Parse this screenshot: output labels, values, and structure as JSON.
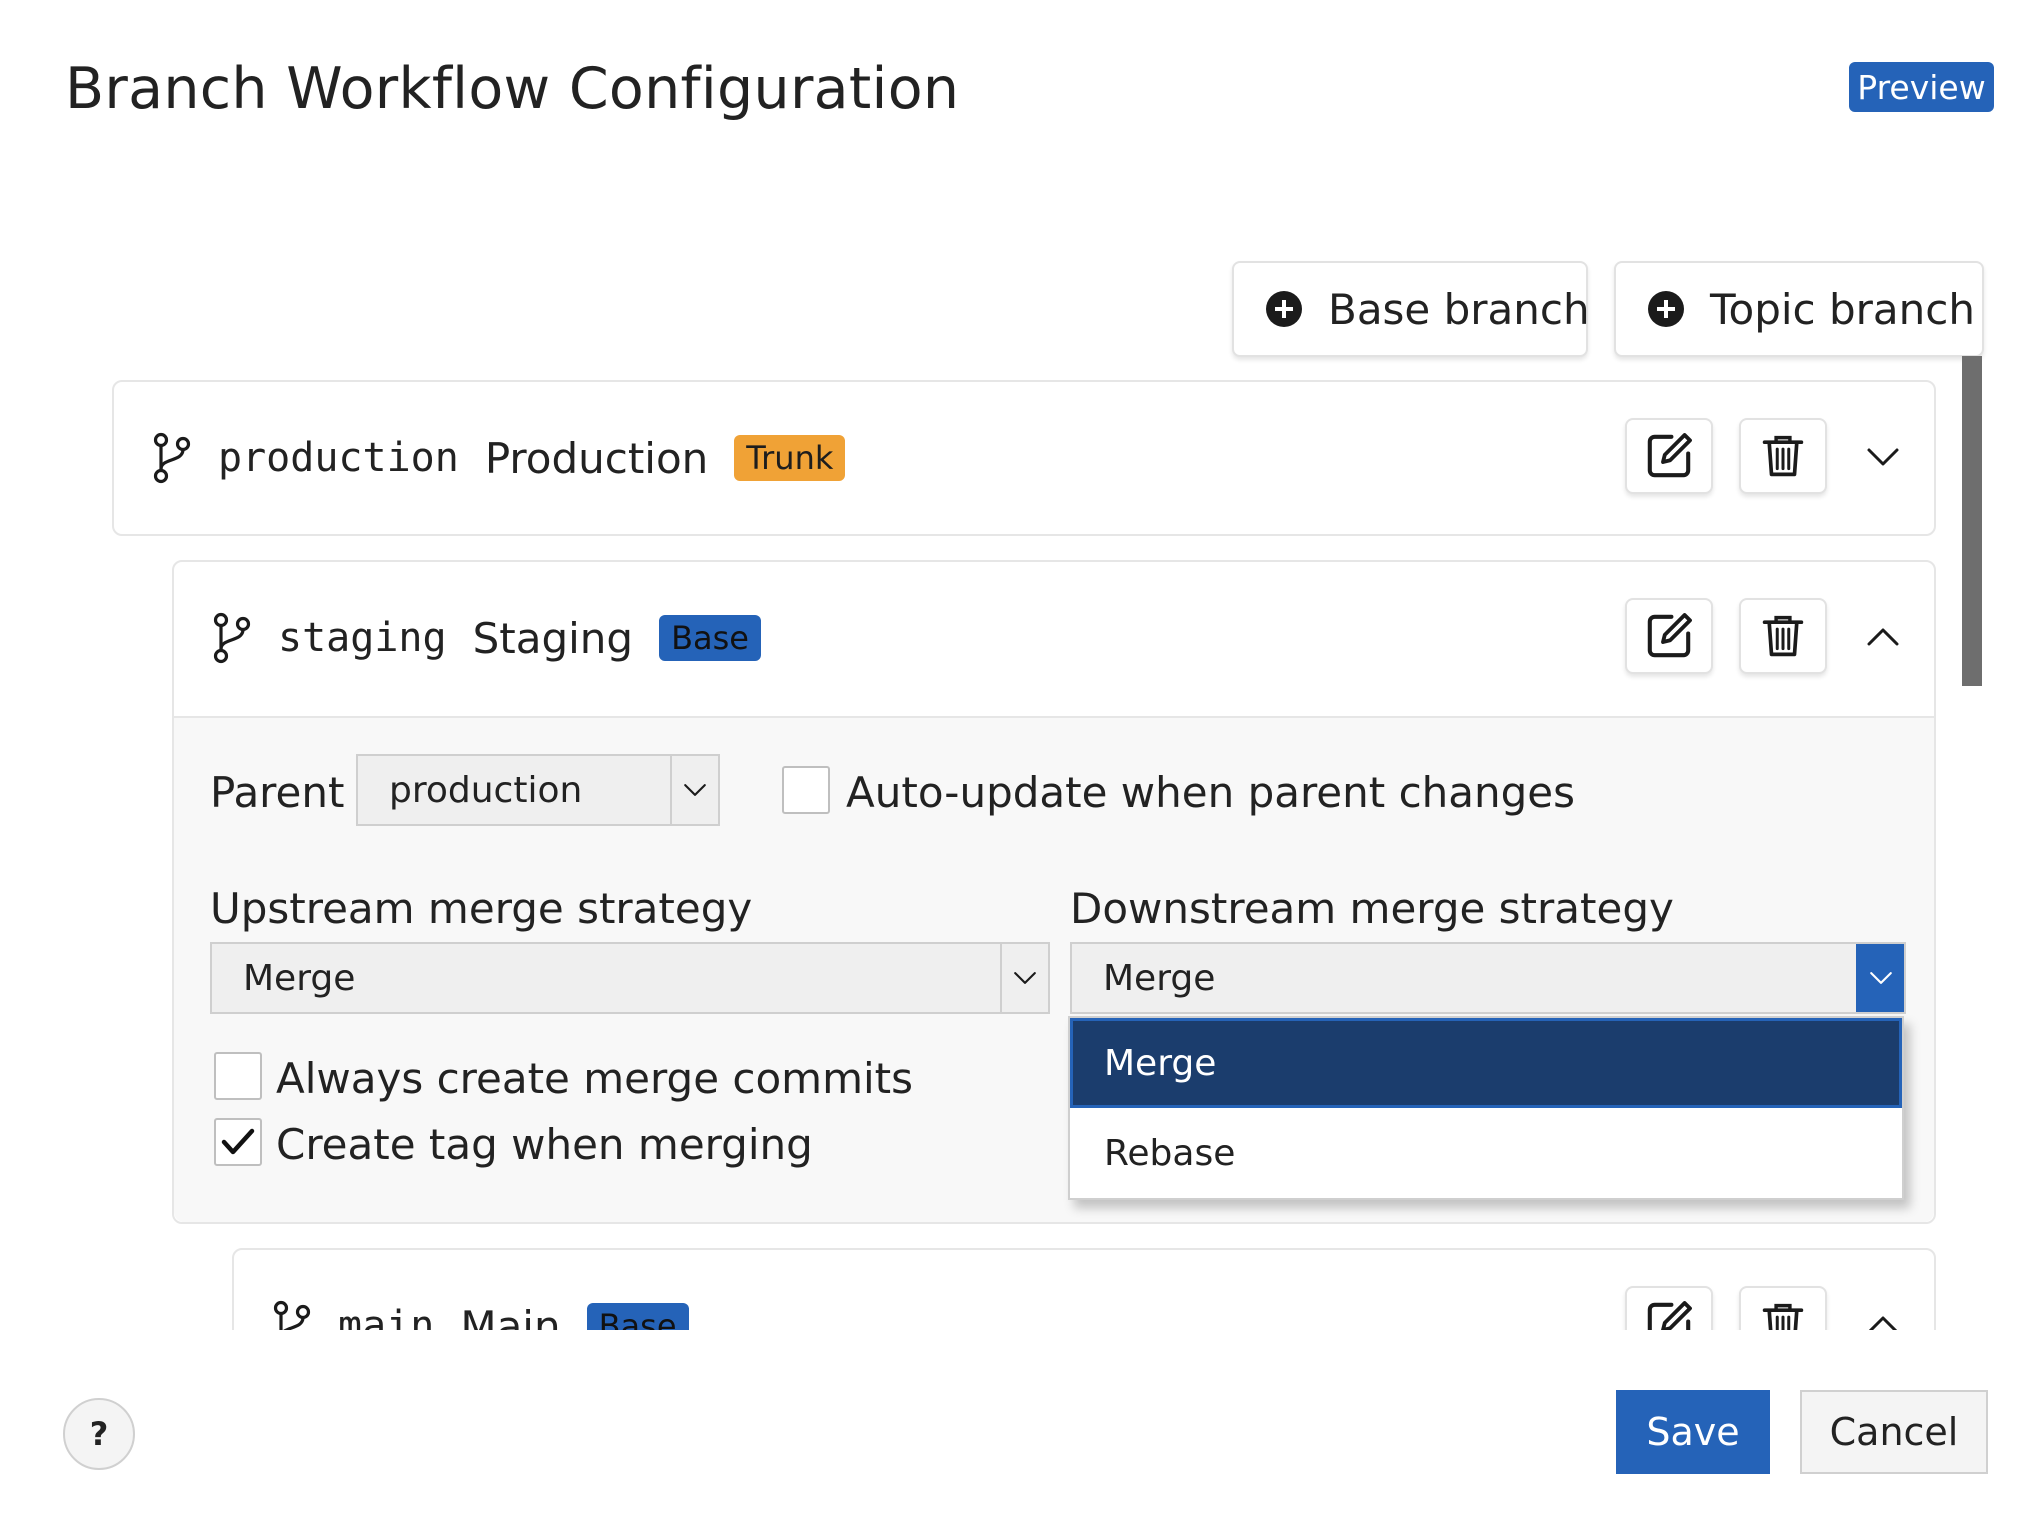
{
  "dialog": {
    "title": "Branch Workflow Configuration",
    "preview_badge": "Preview"
  },
  "toolbar": {
    "add_base_branch_label": "Base branch",
    "add_topic_branch_label": "Topic branch"
  },
  "branches": [
    {
      "code_name": "production",
      "display_name": "Production",
      "badge": "Trunk",
      "expanded": false
    },
    {
      "code_name": "staging",
      "display_name": "Staging",
      "badge": "Base",
      "expanded": true,
      "settings": {
        "parent_label": "Parent",
        "parent_value": "production",
        "auto_update_label": "Auto-update when parent changes",
        "auto_update_checked": false,
        "upstream_label": "Upstream merge strategy",
        "upstream_value": "Merge",
        "downstream_label": "Downstream merge strategy",
        "downstream_value": "Merge",
        "downstream_options": [
          "Merge",
          "Rebase"
        ],
        "downstream_selected_option": "Merge",
        "always_merge_commits_label": "Always create merge commits",
        "always_merge_commits_checked": false,
        "create_tag_label": "Create tag when merging",
        "create_tag_checked": true
      }
    },
    {
      "code_name": "main",
      "display_name": "Main",
      "badge": "Base",
      "expanded": true
    }
  ],
  "footer": {
    "help_label": "?",
    "save_label": "Save",
    "cancel_label": "Cancel"
  },
  "colors": {
    "accent": "#2563b8",
    "trunk_badge": "#f0a236",
    "dropdown_selected": "#1b3d6d"
  },
  "icons": [
    "plus-circle-icon",
    "branch-icon",
    "edit-icon",
    "trash-icon",
    "chevron-down-icon",
    "chevron-up-icon",
    "checkmark-icon"
  ]
}
